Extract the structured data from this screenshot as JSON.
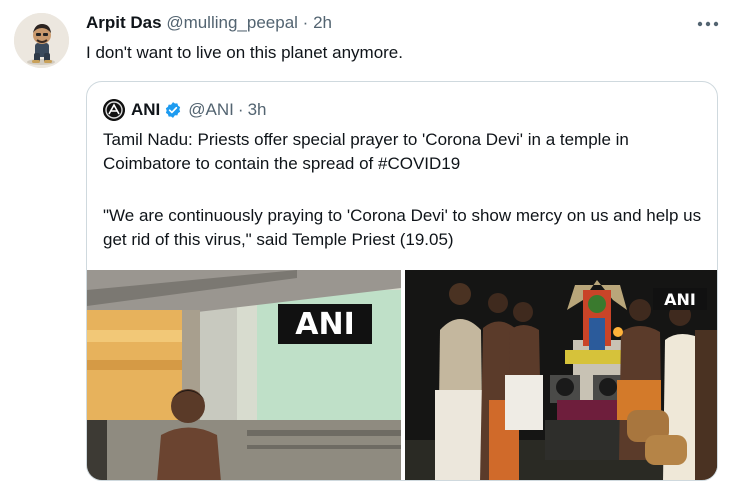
{
  "tweet": {
    "author_name": "Arpit Das",
    "handle": "@mulling_peepal",
    "separator": "·",
    "time": "2h",
    "text": "I don't want to live on this planet anymore.",
    "more_icon": "more-horizontal-icon"
  },
  "quoted": {
    "author_name": "ANI",
    "handle": "@ANI",
    "separator": "·",
    "time": "3h",
    "paragraph1": "Tamil Nadu: Priests offer special prayer to 'Corona Devi' in a temple in Coimbatore to contain the spread of #COVID19",
    "paragraph2": "\"We are continuously praying to 'Corona Devi' to show mercy on us and help us get rid of this virus,\" said Temple Priest (19.05)",
    "verified_color": "#1d9bf0",
    "media": [
      {
        "watermark": "ANI"
      },
      {
        "watermark": "ANI"
      }
    ]
  },
  "colors": {
    "text": "#0f1419",
    "muted": "#536471",
    "border": "#cfd9de"
  }
}
